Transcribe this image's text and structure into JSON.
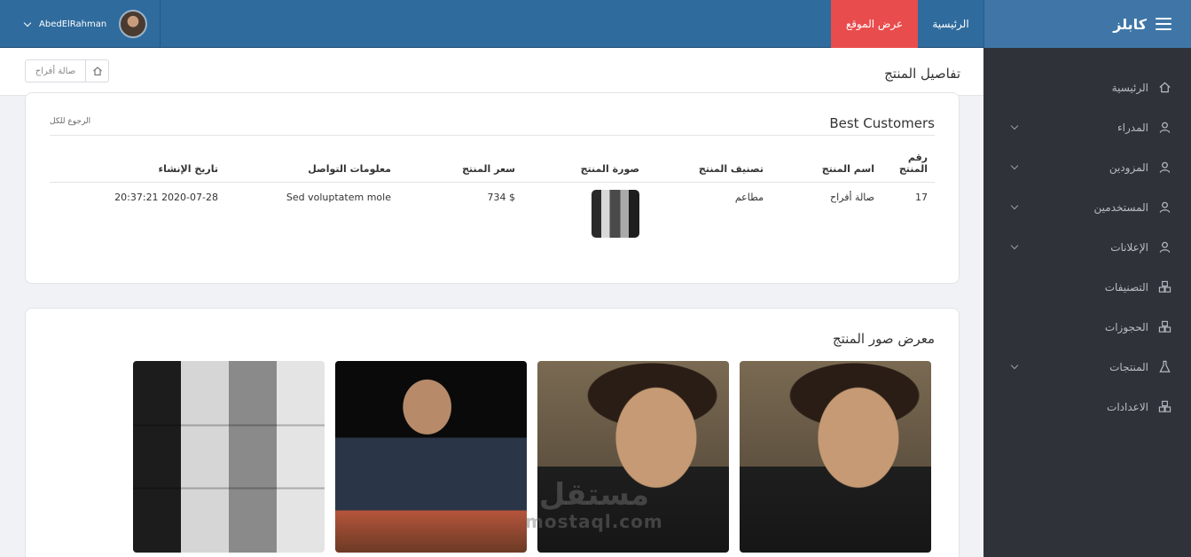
{
  "topbar": {
    "brand": "كابلز",
    "nav_home": "الرئيسية",
    "nav_view_site": "عرض الموقع",
    "user_name": "AbedElRahman"
  },
  "sidebar": {
    "items": [
      {
        "label": "الرئيسية",
        "icon": "home-icon",
        "has_children": false
      },
      {
        "label": "المدراء",
        "icon": "user-icon",
        "has_children": true
      },
      {
        "label": "المزودين",
        "icon": "user-icon",
        "has_children": true
      },
      {
        "label": "المستخدمين",
        "icon": "user-icon",
        "has_children": true
      },
      {
        "label": "الإعلانات",
        "icon": "user-icon",
        "has_children": true
      },
      {
        "label": "التصنيفات",
        "icon": "cubes-icon",
        "has_children": false
      },
      {
        "label": "الحجوزات",
        "icon": "cubes-icon",
        "has_children": false
      },
      {
        "label": "المنتجات",
        "icon": "flask-icon",
        "has_children": true
      },
      {
        "label": "الاعدادات",
        "icon": "cubes-icon",
        "has_children": false
      }
    ]
  },
  "page": {
    "title": "تفاصيل المنتج",
    "breadcrumb": "صالة أفراح"
  },
  "details_card": {
    "title": "Best Customers",
    "back_link": "الرجوع للكل",
    "columns": [
      "رقم المنتج",
      "اسم المنتج",
      "تصنيف المنتج",
      "صورة المنتج",
      "سعر المنتج",
      "معلومات التواصل",
      "تاريخ الإنشاء"
    ],
    "row": {
      "id": "17",
      "name": "صالة أفراح",
      "category": "مطاعم",
      "price": "$ 734",
      "contact": "Sed voluptatem mole",
      "created": "2020-07-28 20:37:21"
    }
  },
  "gallery_card": {
    "title": "معرض صور المنتج"
  },
  "watermark": {
    "arabic": "مستقل",
    "latin": "mostaql.com"
  },
  "colors": {
    "topbar": "#2f6b9d",
    "brandbar": "#3f76a7",
    "accent_red": "#e84c4c",
    "sidebar": "#2f3339"
  }
}
